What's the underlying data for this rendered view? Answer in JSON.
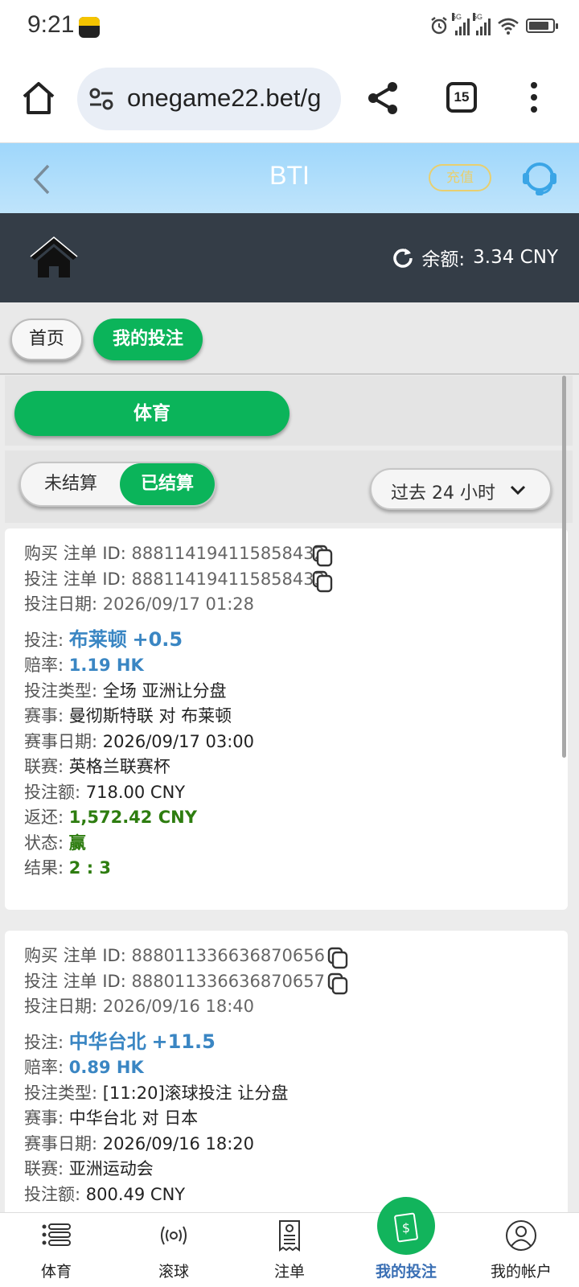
{
  "status_bar": {
    "time": "9:21",
    "network": "5G"
  },
  "browser": {
    "url": "onegame22.bet/g",
    "tab_count": "15"
  },
  "header": {
    "title": "BTI",
    "recharge_label": "充值"
  },
  "balance": {
    "label": "余额:",
    "value": "3.34 CNY"
  },
  "nav_tabs": {
    "home": "首页",
    "my_bets": "我的投注"
  },
  "sport_button": "体育",
  "filter": {
    "unsettled": "未结算",
    "settled": "已结算",
    "period": "过去 24 小时"
  },
  "labels": {
    "buy_id": "购买 注单 ID:",
    "bet_id": "投注 注单 ID:",
    "bet_date": "投注日期:",
    "selection": "投注:",
    "odds": "赔率:",
    "bet_type": "投注类型:",
    "event": "赛事:",
    "event_date": "赛事日期:",
    "league": "联赛:",
    "stake": "投注额:",
    "return": "返还:",
    "status": "状态:",
    "result": "结果:"
  },
  "bets": [
    {
      "buy_id": "888114194115858432",
      "bet_id": "888114194115858433",
      "bet_date": "2026/09/17 01:28",
      "selection": "布莱顿",
      "handicap": "+0.5",
      "odds": "1.19 HK",
      "bet_type": "全场 亚洲让分盘",
      "event": "曼彻斯特联 对 布莱顿",
      "event_date": "2026/09/17 03:00",
      "league": "英格兰联赛杯",
      "stake": "718.00 CNY",
      "return": "1,572.42 CNY",
      "status": "赢",
      "result": "2 : 3"
    },
    {
      "buy_id": "888011336636870656",
      "bet_id": "888011336636870657",
      "bet_date": "2026/09/16 18:40",
      "selection": "中华台北",
      "handicap": "+11.5",
      "odds": "0.89 HK",
      "bet_type": "[11:20]滚球投注 让分盘",
      "event": "中华台北 对 日本",
      "event_date": "2026/09/16 18:20",
      "league": "亚洲运动会",
      "stake": "800.49 CNY"
    }
  ],
  "bottom_nav": [
    {
      "label": "体育",
      "icon": "list-icon"
    },
    {
      "label": "滚球",
      "icon": "live-signal-icon"
    },
    {
      "label": "注单",
      "icon": "receipt-icon"
    },
    {
      "label": "我的投注",
      "icon": "money-ticket-icon"
    },
    {
      "label": "我的帐户",
      "icon": "user-icon"
    }
  ],
  "colors": {
    "accent_green": "#0bb45a",
    "header_blue": "#a8dbfb",
    "dark_bar": "#343d47",
    "link_blue": "#3a86c3",
    "win_green": "#2e7d10"
  }
}
